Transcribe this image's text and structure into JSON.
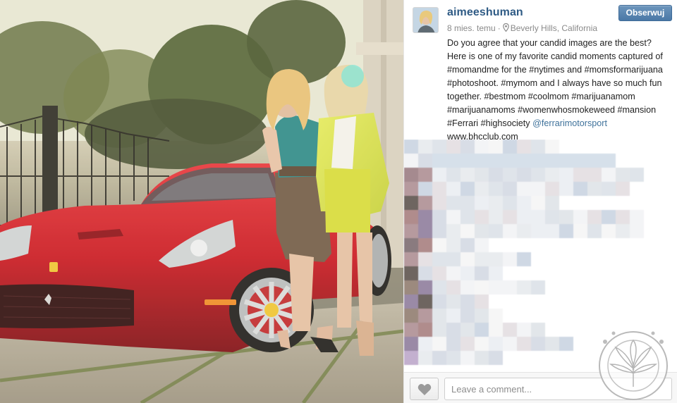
{
  "post": {
    "username": "aimeeshuman",
    "time_ago": "8 mies. temu",
    "separator": "·",
    "location": "Beverly Hills, California",
    "follow_label": "Obserwuj",
    "caption_text": "Do you agree that your candid images are the best? Here is one of my favorite candid moments captured of #momandme for the #nytimes and #momsformarijuana #photoshoot. #mymom and I always have so much fun together. #bestmom #coolmom #marijuanamom #marijuanamoms #womenwhosmokeweed #mansion #Ferrari #highsociety ",
    "caption_mention": "@ferrarimotorsport",
    "caption_link": " www.bhcclub.com"
  },
  "comment_box": {
    "placeholder": "Leave a comment..."
  },
  "icons": {
    "like": "heart-icon",
    "location": "map-pin-icon"
  },
  "colors": {
    "username": "#2f5b85",
    "follow_button": "#4a78a6",
    "mention": "#3f729b",
    "car_red": "#d01a24"
  }
}
